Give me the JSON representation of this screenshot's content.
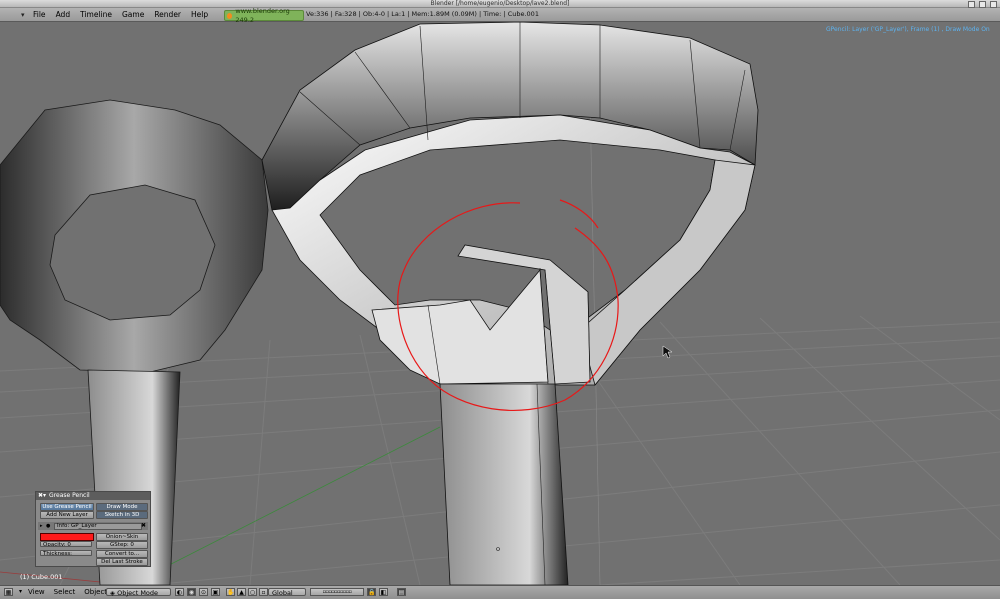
{
  "window": {
    "title": "Blender [/home/eugenio/Desktop/lave2.blend]"
  },
  "top_menu": {
    "items": [
      "File",
      "Add",
      "Timeline",
      "Game",
      "Render",
      "Help"
    ],
    "site": "www.blender.org 249.2",
    "stats": "Ve:336 | Fa:328 | Ob:4-0 | La:1  | Mem:1.89M (0.09M)  | Time: | Cube.001"
  },
  "viewport": {
    "gp_info": "GPencil: Layer ('GP_Layer'), Frame (1) , Draw Mode On",
    "object_label": "(1) Cube.001"
  },
  "grease_pencil_panel": {
    "title": "Grease Pencil",
    "use_btn": "Use Grease Pencil",
    "draw_mode": "Draw Mode",
    "add_layer": "Add New Layer",
    "sketch_3d": "Sketch in 3D",
    "layer_name": "Info: GP_Layer",
    "opacity": "Opacity: 0",
    "onion_skin": "Onion~Skin",
    "gstep": "GStep: 0",
    "thickness": "Thickness:",
    "convert_to": "Convert to...",
    "del_last": "Del Last Stroke",
    "color": "#ff1a1a"
  },
  "bottom_bar": {
    "menus": [
      "View",
      "Select",
      "Object"
    ],
    "mode": "Object Mode",
    "orientation": "Global"
  }
}
